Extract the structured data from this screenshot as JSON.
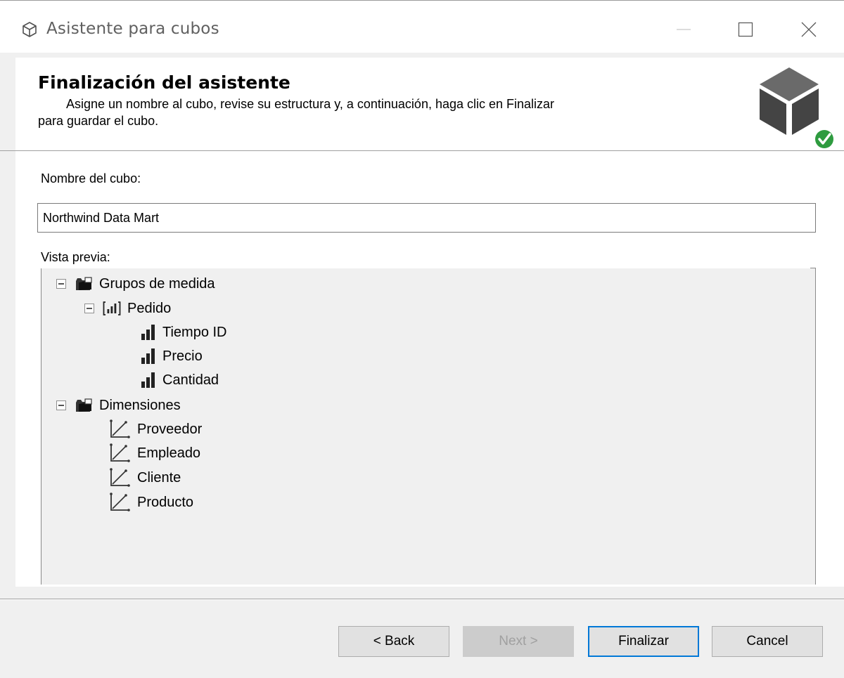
{
  "window": {
    "title": "Asistente para cubos",
    "app_icon": "cube-outline-icon",
    "controls": [
      "minimize-icon",
      "maximize-icon",
      "close-icon"
    ]
  },
  "header": {
    "title": "Finalización del asistente",
    "description_line1": "Asigne un nombre al cubo, revise su estructura y, a continuación, haga clic en Finalizar",
    "description_line2": "para guardar el cubo.",
    "icon": "cube-check-icon",
    "icon_check_color": "#2e9b3f"
  },
  "form": {
    "cube_name_label": "Nombre del cubo:",
    "cube_name_value": "Northwind Data Mart",
    "preview_label": "Vista previa:"
  },
  "tree": {
    "measure_groups": {
      "label": "Grupos de medida",
      "icon": "folder-icon",
      "expanded": true,
      "group": {
        "label": "Pedido",
        "icon": "measure-group-icon",
        "expanded": true,
        "measures": [
          {
            "label": "Tiempo ID",
            "icon": "measure-icon"
          },
          {
            "label": "Precio",
            "icon": "measure-icon"
          },
          {
            "label": "Cantidad",
            "icon": "measure-icon"
          }
        ]
      }
    },
    "dimensions": {
      "label": "Dimensiones",
      "icon": "folder-icon",
      "expanded": true,
      "items": [
        {
          "label": "Proveedor",
          "icon": "dimension-icon"
        },
        {
          "label": "Empleado",
          "icon": "dimension-icon"
        },
        {
          "label": "Cliente",
          "icon": "dimension-icon"
        },
        {
          "label": "Producto",
          "icon": "dimension-icon"
        }
      ]
    }
  },
  "buttons": {
    "back": "< Back",
    "next": "Next >",
    "finish": "Finalizar",
    "cancel": "Cancel",
    "next_enabled": false,
    "default_button": "finish",
    "focus_color": "#0078d7"
  }
}
